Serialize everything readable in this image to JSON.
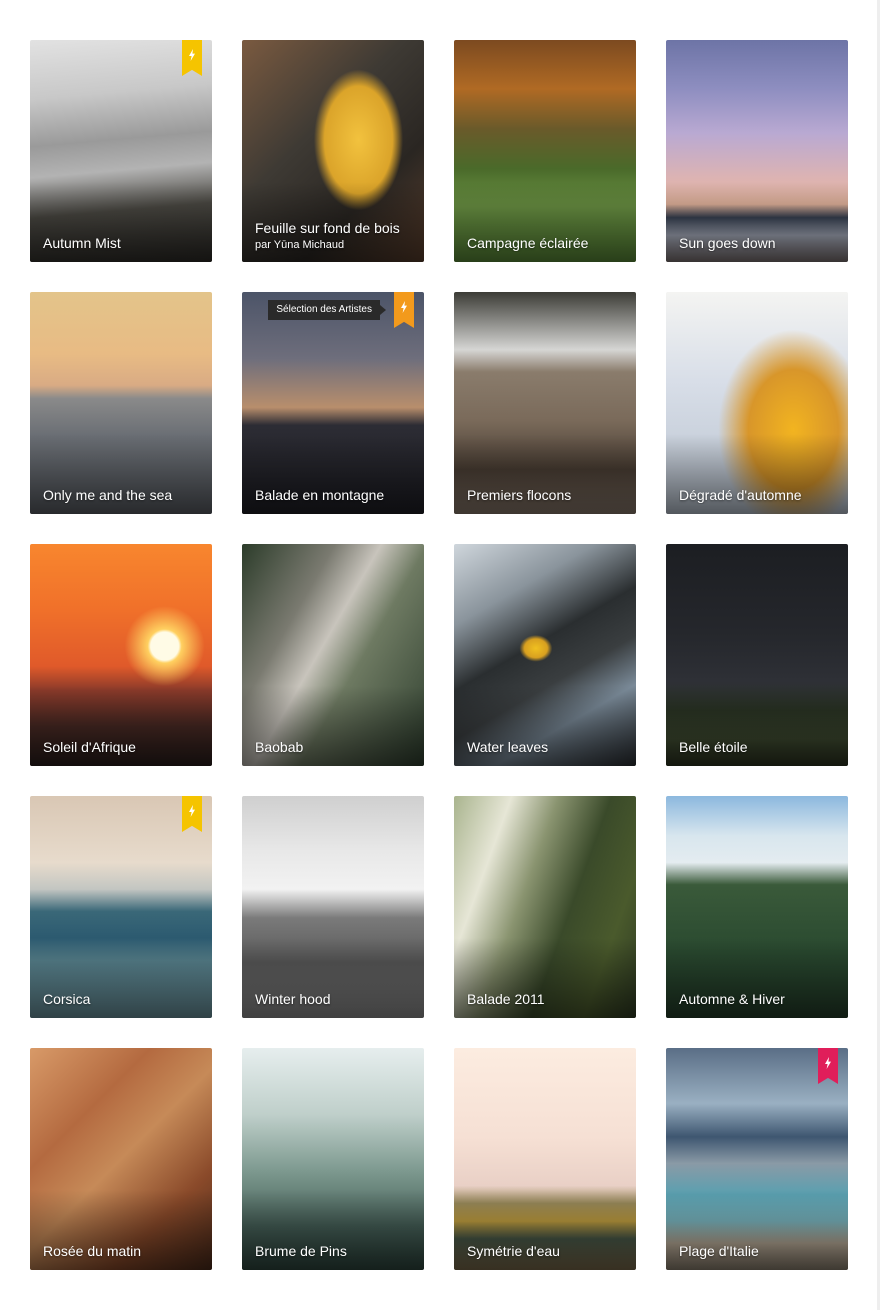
{
  "gallery": {
    "tiles": [
      {
        "title": "Autumn Mist",
        "bg": "linear-gradient(175deg,#e2e2e2 0%,#c8c8c8 25%,#9a9a9a 45%,#b3b3b3 58%,#4c4a44 75%,#2c2a26 100%)",
        "badge": "yellow"
      },
      {
        "title": "Feuille sur fond de bois",
        "byline": "par Yūna Michaud",
        "bg": "radial-gradient(ellipse 34% 44% at 64% 45%,#f2c23e 0%,#dba42a 55%,rgba(0,0,0,0) 72%),linear-gradient(135deg,#7a5a40 0%,#3e3a34 40%,#2a2622 70%,#5a3e2c 100%)"
      },
      {
        "title": "Campagne éclairée",
        "bg": "linear-gradient(180deg,#7c4a20 0%,#b06a24 22%,#6a5a2a 40%,#4a6a2a 58%,#6c9444 75%,#5a8a38 100%)"
      },
      {
        "title": "Sun goes down",
        "bg": "linear-gradient(180deg,#6d74a6 0%,#8e8ec0 22%,#b9a9d2 42%,#dcb3b3 62%,#e6b69e 74%,#3a4456 80%,#aab0c0 88%,#7a7070 100%)"
      },
      {
        "title": "Only me and the sea",
        "bg": "linear-gradient(180deg,#e3c48a 0%,#e8bb84 28%,#d9ab84 42%,#8a8a8a 48%,#6a6e74 65%,#595d63 100%)"
      },
      {
        "title": "Balade en montagne",
        "bg": "linear-gradient(180deg,#4c5468 0%,#6e6e7c 30%,#b88e6c 52%,#2c2c34 60%,#1e1e24 100%)",
        "badge": "orange",
        "tooltip": "Sélection des Artistes"
      },
      {
        "title": "Premiers flocons",
        "bg": "linear-gradient(180deg,#3c3c36 0%,#d6d6d4 26%,#8a7c6c 36%,#7a6a5a 58%,#4a3e34 80%,#8a7a6c 100%)"
      },
      {
        "title": "Dégradé d'automne",
        "bg": "radial-gradient(ellipse 55% 60% at 70% 62%,#f2b420 0%,#d8962a 45%,rgba(0,0,0,0) 75%),linear-gradient(180deg,#f4f4f2 0%,#d8dee8 40%,#b8c2ce 100%)"
      },
      {
        "title": "Soleil d'Afrique",
        "bg": "radial-gradient(circle at 74% 46%,#fffbe6 0,#fffbe6 14px,#ffd060 17px,rgba(255,160,60,0) 40px),linear-gradient(180deg,#f8862e 0%,#f0702a 30%,#e05a2a 55%,#8a3a2a 66%,#4a2a24 82%,#2a1e1c 100%)"
      },
      {
        "title": "Baobab",
        "bg": "linear-gradient(120deg,#2c3c2a 0%,#7a7a70 30%,#c8c4bc 45%,#6e7a62 60%,#2e3e2e 100%)"
      },
      {
        "title": "Water leaves",
        "bg": "radial-gradient(ellipse 9% 6% at 45% 47%,#f0c020 0%,#d8a020 70%,rgba(0,0,0,0) 100%),linear-gradient(150deg,#cfd6dc 0%,#8a949c 25%,#2a2e30 45%,#3a3e40 60%,#7a8a98 75%,#2a2e32 100%)"
      },
      {
        "title": "Belle étoile",
        "bg": "linear-gradient(180deg,#1c1e22 0%,#25272c 40%,#2e3036 62%,#2a3424 75%,#3e4a30 88%,#2c3420 100%)"
      },
      {
        "title": "Corsica",
        "bg": "linear-gradient(180deg,#d9c7b4 0%,#e7dbcc 30%,#c3c6c2 42%,#3a6878 52%,#2c5a70 64%,#5a8692 74%,#6a929c 100%)",
        "badge": "yellow"
      },
      {
        "title": "Winter hood",
        "bg": "linear-gradient(180deg,#cfcfcf 0%,#e8e8e8 25%,#f2f2f2 42%,#7a7a7a 55%,#5a5a5a 75%,#8e8e8e 100%)"
      },
      {
        "title": "Balade 2011",
        "bg": "linear-gradient(110deg,#a9b48e 0%,#e6e6d6 22%,#8a9470 40%,#3a4a2a 60%,#4a5a2c 80%,#2e3a22 100%)"
      },
      {
        "title": "Automne & Hiver",
        "bg": "linear-gradient(180deg,#8cb8de 0%,#d8e6ee 18%,#e4ecf0 30%,#3a5a3a 40%,#2a4a30 70%,#243e2a 100%)"
      },
      {
        "title": "Rosée du matin",
        "bg": "linear-gradient(135deg,#d89a68 0%,#b46a40 30%,#c68a58 50%,#8a4a2a 75%,#4a2a1a 100%)"
      },
      {
        "title": "Brume de Pins",
        "bg": "linear-gradient(180deg,#e6eeee 0%,#bfcfca 30%,#7e9a90 55%,#466058 80%,#2e463e 100%)"
      },
      {
        "title": "Symétrie d'eau",
        "bg": "linear-gradient(180deg,#fcece0 0%,#f6e0d4 40%,#e9d0c6 62%,#9a8a5a 70%,#c2a040 78%,#4a5a4a 86%,#7a6a4a 100%)"
      },
      {
        "title": "Plage d'Italie",
        "bg": "linear-gradient(180deg,#5a6e86 0%,#9ab0c2 25%,#3e5670 40%,#8a9aa6 52%,#5aa0b0 66%,#7ab6c0 78%,#bcae9a 88%,#8a7e6e 100%)",
        "badge": "pink"
      }
    ]
  },
  "badge_colors": {
    "yellow": "#f5c400",
    "orange": "#f39a1c",
    "pink": "#e01e5a"
  },
  "badge_icon": "lightning-bolt-icon"
}
